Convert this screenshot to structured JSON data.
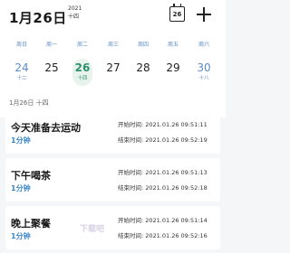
{
  "header": {
    "title": "1月26日",
    "year": "2021",
    "weekday": "十四",
    "calendar_day": "26",
    "add_label": "+"
  },
  "week_days": [
    "周日",
    "周一",
    "周二",
    "周三",
    "周四",
    "周五",
    "周六"
  ],
  "dates": [
    {
      "num": "24",
      "lunar": "十二"
    },
    {
      "num": "25",
      "lunar": ""
    },
    {
      "num": "26",
      "lunar": "十四"
    },
    {
      "num": "27",
      "lunar": ""
    },
    {
      "num": "28",
      "lunar": ""
    },
    {
      "num": "29",
      "lunar": ""
    },
    {
      "num": "30",
      "lunar": "十八"
    }
  ],
  "section_label": "1月26日  十四",
  "records": [
    {
      "name": "今天准备去运动",
      "duration": "1分钟",
      "start": "开始时间: 2021.01.26 09:51:11",
      "end": "结束时间: 2021.01.26 09:52:19"
    },
    {
      "name": "下午喝茶",
      "duration": "1分钟",
      "start": "开始时间: 2021.01.26 09:51:13",
      "end": "结束时间: 2021.01.26 09:52:18"
    },
    {
      "name": "晚上聚餐",
      "duration": "1分钟",
      "start": "开始时间: 2021.01.26 09:51:14",
      "end": "结束时间: 2021.01.26 09:52:16"
    }
  ],
  "watermark": "下载吧",
  "colors": {
    "accent": "#3a86c8",
    "selected": "#2f8f6e",
    "weekend": "#5b8cc6"
  }
}
